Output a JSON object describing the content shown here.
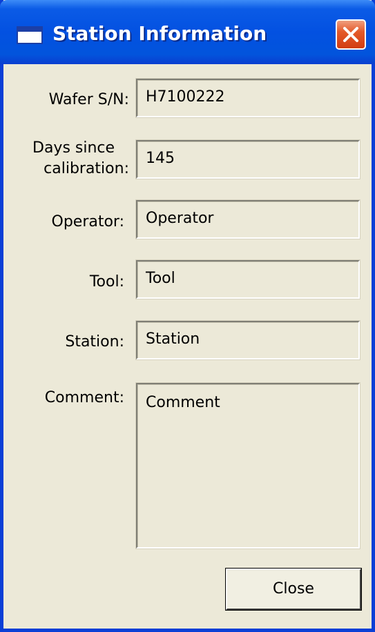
{
  "window": {
    "title": "Station Information",
    "title_icon": "window-icon",
    "close_icon": "close-icon"
  },
  "fields": {
    "wafer_sn": {
      "label": "Wafer S/N:",
      "value": "H7100222"
    },
    "days_since_calibration": {
      "label_line1": "Days since",
      "label_line2": "calibration:",
      "value": "145"
    },
    "operator": {
      "label": "Operator:",
      "value": "Operator"
    },
    "tool": {
      "label": "Tool:",
      "value": "Tool"
    },
    "station": {
      "label": "Station:",
      "value": "Station"
    },
    "comment": {
      "label": "Comment:",
      "value": "Comment"
    }
  },
  "buttons": {
    "close_label": "Close"
  },
  "colors": {
    "titlebar": "#0351e1",
    "window_bg": "#ece9d8",
    "close_button_red": "#e45a2a"
  }
}
